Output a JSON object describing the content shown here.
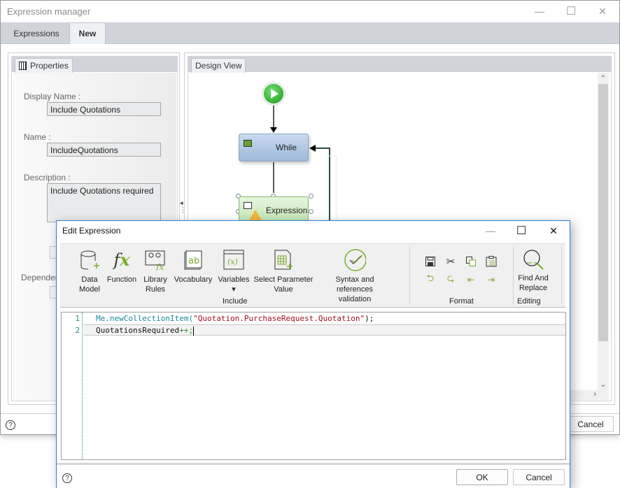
{
  "main_window": {
    "title": "Expression manager",
    "controls": {
      "minimize": "—",
      "maximize": "☐",
      "close": "✕"
    },
    "tabs": [
      {
        "label": "Expressions",
        "active": false
      },
      {
        "label": "New",
        "active": true
      }
    ],
    "properties_panel": {
      "tab_label": "Properties",
      "display_name_label": "Display Name :",
      "display_name_value": "Include Quotations",
      "name_label": "Name :",
      "name_value": "IncludeQuotations",
      "description_label": "Description :",
      "description_value": "Include Quotations required",
      "dependencies_label": "Dependen"
    },
    "design_panel": {
      "tab_label": "Design View",
      "nodes": [
        {
          "type": "start",
          "label": ""
        },
        {
          "type": "while",
          "label": "While"
        },
        {
          "type": "expression",
          "label": "Expression",
          "warning": true
        }
      ]
    },
    "footer": {
      "help": "?",
      "cancel_label": "Cancel"
    }
  },
  "dialog": {
    "title": "Edit Expression",
    "controls": {
      "minimize": "—",
      "maximize": "☐",
      "close": "✕"
    },
    "ribbon": {
      "include_items": [
        {
          "label": "Data\nModel",
          "icon": "data-model-icon"
        },
        {
          "label": "Function",
          "icon": "function-icon"
        },
        {
          "label": "Library\nRules",
          "icon": "library-rules-icon"
        },
        {
          "label": "Vocabulary",
          "icon": "vocabulary-icon"
        },
        {
          "label": "Variables\n▾",
          "icon": "variables-icon"
        },
        {
          "label": "Select Parameter\nValue",
          "icon": "select-parameter-icon"
        },
        {
          "label": "Syntax and references\nvalidation",
          "icon": "validation-icon"
        }
      ],
      "include_group": "Include",
      "format_group": "Format",
      "format_items": [
        "save",
        "cut",
        "copy",
        "paste",
        "undo",
        "redo",
        "outdent",
        "indent"
      ],
      "find_replace_label": "Find And\nReplace",
      "editing_group": "Editing"
    },
    "editor": {
      "lines": [
        {
          "no": "1",
          "tokens": [
            {
              "t": "Me.newCollectionItem(",
              "k": "id"
            },
            {
              "t": "\"Quotation.PurchaseRequest.Quotation\"",
              "k": "str"
            },
            {
              "t": ");",
              "k": "plain"
            }
          ]
        },
        {
          "no": "2",
          "tokens": [
            {
              "t": "QuotationsRequired",
              "k": "plain"
            },
            {
              "t": "++;",
              "k": "op"
            }
          ]
        }
      ]
    },
    "footer": {
      "help": "?",
      "ok_label": "OK",
      "cancel_label": "Cancel"
    }
  }
}
